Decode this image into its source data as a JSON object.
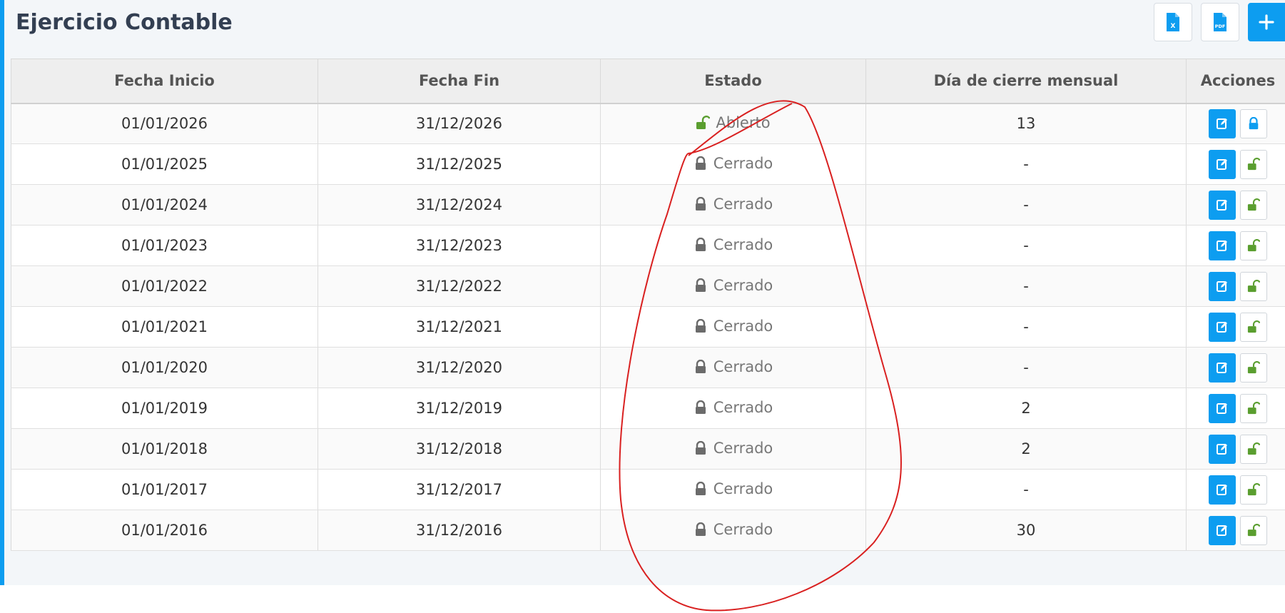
{
  "page": {
    "title": "Ejercicio Contable"
  },
  "toolbar": {
    "buttons": [
      {
        "icon": "excel-file-icon",
        "label": "X"
      },
      {
        "icon": "pdf-file-icon",
        "label": "PDF"
      },
      {
        "icon": "plus-icon",
        "label": "+"
      }
    ]
  },
  "table": {
    "columns": [
      "Fecha Inicio",
      "Fecha Fin",
      "Estado",
      "Día de cierre mensual",
      "Acciones"
    ],
    "rows": [
      {
        "inicio": "01/01/2026",
        "fin": "31/12/2026",
        "estado": "Abierto",
        "locked": false,
        "cierre": "13"
      },
      {
        "inicio": "01/01/2025",
        "fin": "31/12/2025",
        "estado": "Cerrado",
        "locked": true,
        "cierre": "-"
      },
      {
        "inicio": "01/01/2024",
        "fin": "31/12/2024",
        "estado": "Cerrado",
        "locked": true,
        "cierre": "-"
      },
      {
        "inicio": "01/01/2023",
        "fin": "31/12/2023",
        "estado": "Cerrado",
        "locked": true,
        "cierre": "-"
      },
      {
        "inicio": "01/01/2022",
        "fin": "31/12/2022",
        "estado": "Cerrado",
        "locked": true,
        "cierre": "-"
      },
      {
        "inicio": "01/01/2021",
        "fin": "31/12/2021",
        "estado": "Cerrado",
        "locked": true,
        "cierre": "-"
      },
      {
        "inicio": "01/01/2020",
        "fin": "31/12/2020",
        "estado": "Cerrado",
        "locked": true,
        "cierre": "-"
      },
      {
        "inicio": "01/01/2019",
        "fin": "31/12/2019",
        "estado": "Cerrado",
        "locked": true,
        "cierre": "2"
      },
      {
        "inicio": "01/01/2018",
        "fin": "31/12/2018",
        "estado": "Cerrado",
        "locked": true,
        "cierre": "2"
      },
      {
        "inicio": "01/01/2017",
        "fin": "31/12/2017",
        "estado": "Cerrado",
        "locked": true,
        "cierre": "-"
      },
      {
        "inicio": "01/01/2016",
        "fin": "31/12/2016",
        "estado": "Cerrado",
        "locked": true,
        "cierre": "30"
      }
    ]
  },
  "colors": {
    "accent": "#0d9df0",
    "open": "#5a9e2f",
    "closed": "#6b6b6b",
    "annotation": "#d92020"
  }
}
